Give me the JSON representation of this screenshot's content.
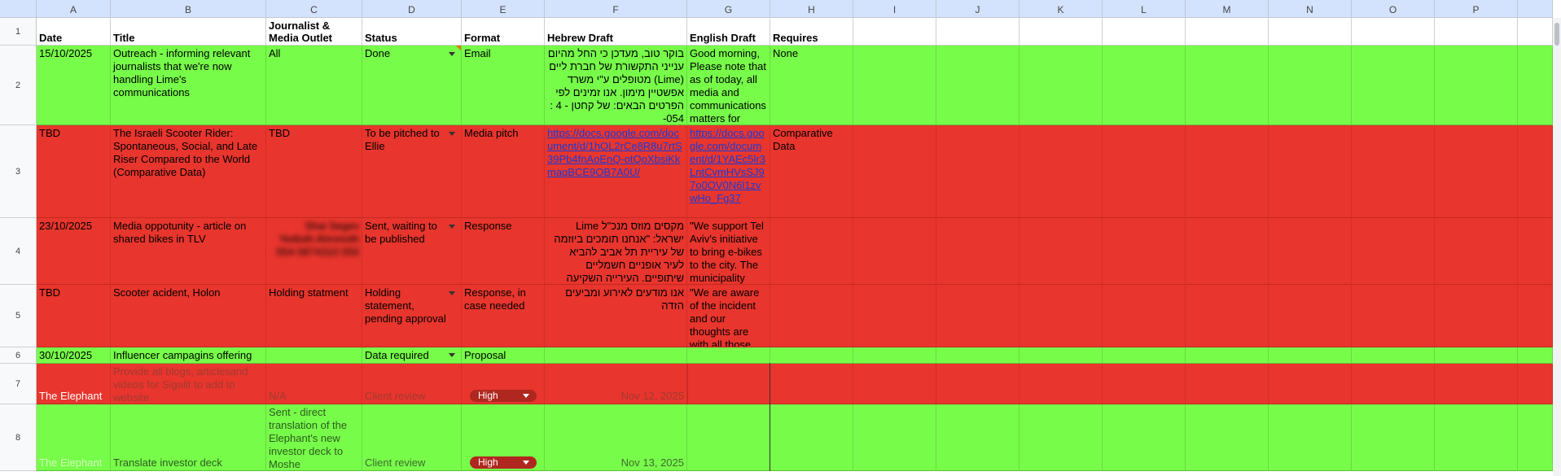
{
  "columns": [
    "A",
    "B",
    "C",
    "D",
    "E",
    "F",
    "G",
    "H",
    "I",
    "J",
    "K",
    "L",
    "M",
    "N",
    "O",
    "P"
  ],
  "row_numbers": [
    "1",
    "2",
    "3",
    "4",
    "5",
    "6",
    "7",
    "8"
  ],
  "header": {
    "date": "Date",
    "title": "Title",
    "journalist": "Journalist & Media Outlet",
    "status": "Status",
    "format": "Format",
    "hebrew": "Hebrew Draft",
    "english": "English Draft",
    "requires": "Requires"
  },
  "rows": [
    {
      "date": "15/10/2025",
      "title": "Outreach - informing relevant journalists that we're now handling Lime's communications",
      "journalist": "All",
      "status": "Done",
      "format": "Email",
      "hebrew": "בוקר טוב, מעדכן כי החל מהיום ענייני התקשורת של חברת ליים (Lime) מטופלים ע\"י משרד אפשטיין מימון. אנו זמינים לפי הפרטים הבאים: של קחטן - 4 : 054-",
      "english": "Good morning, Please note that as of today, all media and communications matters for",
      "requires": "None"
    },
    {
      "date": "TBD",
      "title": "The Israeli Scooter Rider: Spontaneous, Social, and Late Riser Compared to the World (Comparative Data)",
      "journalist": "TBD",
      "status": "To be pitched to Ellie",
      "format": "Media pitch",
      "hebrew": "https://docs.google.com/document/d/1hOL2rCe8R8u7rtS39Pb4fnAoEnQ-otQoXbsiKkmaqBCE9OB7A0U/",
      "english": "https://docs.google.com/document/d/1YAEc5lr3LntCvmHVsSJ97o0OV0N6l1zvwHo_Fg37",
      "requires": "Comparative Data"
    },
    {
      "date": "23/10/2025",
      "title": "Media oppotunity - article on shared bikes in TLV",
      "journalist": "Shai Segev Yedioth Ahronoth 054-5874310 050",
      "status": "Sent, waiting to be published",
      "format": "Response",
      "hebrew": "מקסים מוזס מנכ\"ל Lime ישראל: \"אנחנו תומכים ביוזמה של עיריית תל אביב להביא לעיר אופניים חשמליים שיתופיים. העירייה השקיעה משאבים רבים",
      "english": "\"We support Tel Aviv's initiative to bring e-bikes to the city. The municipality",
      "requires": ""
    },
    {
      "date": "TBD",
      "title": "Scooter acident, Holon",
      "journalist": "Holding statment",
      "status": "Holding statement, pending approval",
      "format": "Response, in case needed",
      "hebrew": "אנו מודעים לאירוע ומביעים הזדה",
      "english": "\"We are aware of the incident and our thoughts are with all those",
      "requires": ""
    },
    {
      "date": "30/10/2025",
      "title": "Influencer campagins offering",
      "journalist": "",
      "status": "Data required",
      "format": "Proposal",
      "hebrew": "",
      "english": "",
      "requires": ""
    },
    {
      "date": "The Elephant",
      "title": "Provide all blogs, articlesand videos for Sigalit to add to website",
      "journalist": "N/A",
      "status": "Client review",
      "format": "High",
      "hebrew": "Nov 12, 2025",
      "english": "",
      "requires": ""
    },
    {
      "date": "The Elephant",
      "title": "Translate investor deck",
      "journalist": "Sent - direct translation of the Elephant's new investor deck to Moshe",
      "status": "Client review",
      "format": "High",
      "hebrew": "Nov 13, 2025",
      "english": "",
      "requires": ""
    }
  ],
  "colors": {
    "green_row": "#77fc4a",
    "red_row": "#e8352d",
    "column_header": "#d3e3fd",
    "chip": "#b0271f",
    "link": "#1a3bd6"
  }
}
